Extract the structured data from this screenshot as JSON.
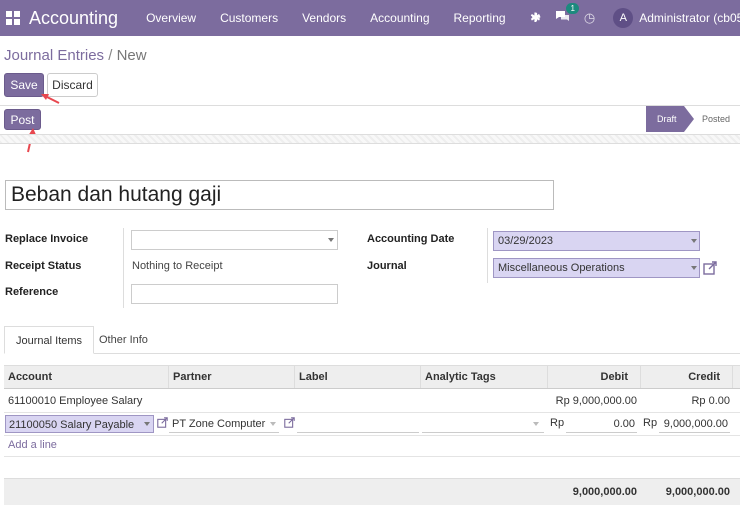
{
  "navbar": {
    "brand": "Accounting",
    "menu": [
      "Overview",
      "Customers",
      "Vendors",
      "Accounting",
      "Reporting"
    ],
    "plus": "+",
    "chat_count": "1",
    "avatar_letter": "A",
    "user": "Administrator (cb05"
  },
  "breadcrumb": {
    "parent": "Journal Entries",
    "separator": "/",
    "current": "New"
  },
  "buttons": {
    "save": "Save",
    "discard": "Discard",
    "post": "Post"
  },
  "status": {
    "stages": [
      "Draft",
      "Posted"
    ],
    "active": "Draft"
  },
  "form": {
    "title": "Beban dan hutang gaji",
    "replace_invoice_label": "Replace Invoice",
    "replace_invoice_value": "",
    "receipt_status_label": "Receipt Status",
    "receipt_status_value": "Nothing to Receipt",
    "reference_label": "Reference",
    "reference_value": "",
    "accounting_date_label": "Accounting Date",
    "accounting_date_value": "03/29/2023",
    "journal_label": "Journal",
    "journal_value": "Miscellaneous Operations"
  },
  "tabs": [
    {
      "label": "Journal Items",
      "active": true
    },
    {
      "label": "Other Info",
      "active": false
    }
  ],
  "table": {
    "columns": [
      "Account",
      "Partner",
      "Label",
      "Analytic Tags",
      "Debit",
      "Credit"
    ],
    "rows": [
      {
        "account": "61100010 Employee Salary",
        "partner": "",
        "label": "",
        "tags": "",
        "debit": "Rp 9,000,000.00",
        "credit": "Rp 0.00"
      },
      {
        "account": "21100050 Salary Payable",
        "partner": "PT Zone Computer",
        "label": "",
        "tags": "",
        "debit_currency": "Rp",
        "debit": "0.00",
        "credit_currency": "Rp",
        "credit": "9,000,000.00"
      }
    ],
    "add_line": "Add a line",
    "totals": {
      "debit": "9,000,000.00",
      "credit": "9,000,000.00"
    }
  },
  "colors": {
    "primary": "#7c6c9e",
    "required_field": "#d9d5f2",
    "annotation_arrow": "#e8474f"
  }
}
